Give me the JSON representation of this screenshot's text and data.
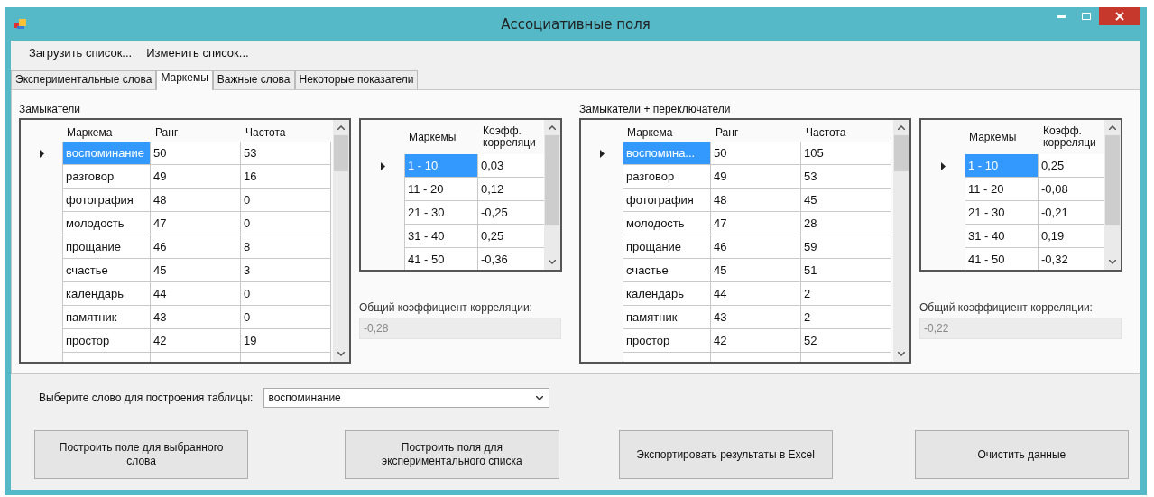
{
  "window": {
    "title": "Ассоциативные поля"
  },
  "menu": [
    {
      "label": "Загрузить список..."
    },
    {
      "label": "Изменить список..."
    }
  ],
  "tabs": [
    {
      "label": "Экспериментальные слова",
      "selected": false
    },
    {
      "label": "Маркемы",
      "selected": true
    },
    {
      "label": "Важные слова",
      "selected": false
    },
    {
      "label": "Некоторые показатели",
      "selected": false
    }
  ],
  "panels": [
    {
      "title": "Замыкатели",
      "grid": {
        "columns": [
          "Маркема",
          "Ранг",
          "Частота"
        ],
        "rows": [
          {
            "selected": true,
            "cells": [
              "воспоминание",
              "50",
              "53"
            ]
          },
          {
            "selected": false,
            "cells": [
              "разговор",
              "49",
              "16"
            ]
          },
          {
            "selected": false,
            "cells": [
              "фотография",
              "48",
              "0"
            ]
          },
          {
            "selected": false,
            "cells": [
              "молодость",
              "47",
              "0"
            ]
          },
          {
            "selected": false,
            "cells": [
              "прощание",
              "46",
              "8"
            ]
          },
          {
            "selected": false,
            "cells": [
              "счастье",
              "45",
              "3"
            ]
          },
          {
            "selected": false,
            "cells": [
              "календарь",
              "44",
              "0"
            ]
          },
          {
            "selected": false,
            "cells": [
              "памятник",
              "43",
              "0"
            ]
          },
          {
            "selected": false,
            "cells": [
              "простор",
              "42",
              "19"
            ]
          }
        ]
      },
      "range_grid": {
        "columns": [
          "Маркемы",
          "Коэфф. корреляци"
        ],
        "rows": [
          {
            "selected": true,
            "cells": [
              "1 - 10",
              "0,03"
            ]
          },
          {
            "selected": false,
            "cells": [
              "11 - 20",
              "0,12"
            ]
          },
          {
            "selected": false,
            "cells": [
              "21 - 30",
              "-0,25"
            ]
          },
          {
            "selected": false,
            "cells": [
              "31 - 40",
              "0,25"
            ]
          },
          {
            "selected": false,
            "cells": [
              "41 - 50",
              "-0,36"
            ]
          }
        ]
      },
      "correlation": {
        "label": "Общий коэффициент корреляции:",
        "value": "-0,28",
        "disabled": true
      }
    },
    {
      "title": "Замыкатели + переключатели",
      "grid": {
        "columns": [
          "Маркема",
          "Ранг",
          "Частота"
        ],
        "rows": [
          {
            "selected": true,
            "cells": [
              "воспомина...",
              "50",
              "105"
            ]
          },
          {
            "selected": false,
            "cells": [
              "разговор",
              "49",
              "53"
            ]
          },
          {
            "selected": false,
            "cells": [
              "фотография",
              "48",
              "45"
            ]
          },
          {
            "selected": false,
            "cells": [
              "молодость",
              "47",
              "28"
            ]
          },
          {
            "selected": false,
            "cells": [
              "прощание",
              "46",
              "59"
            ]
          },
          {
            "selected": false,
            "cells": [
              "счастье",
              "45",
              "51"
            ]
          },
          {
            "selected": false,
            "cells": [
              "календарь",
              "44",
              "2"
            ]
          },
          {
            "selected": false,
            "cells": [
              "памятник",
              "43",
              "2"
            ]
          },
          {
            "selected": false,
            "cells": [
              "простор",
              "42",
              "52"
            ]
          }
        ]
      },
      "range_grid": {
        "columns": [
          "Маркемы",
          "Коэфф. корреляци"
        ],
        "rows": [
          {
            "selected": true,
            "cells": [
              "1 - 10",
              "0,25"
            ]
          },
          {
            "selected": false,
            "cells": [
              "11 - 20",
              "-0,08"
            ]
          },
          {
            "selected": false,
            "cells": [
              "21 - 30",
              "-0,21"
            ]
          },
          {
            "selected": false,
            "cells": [
              "31 - 40",
              "0,19"
            ]
          },
          {
            "selected": false,
            "cells": [
              "41 - 50",
              "-0,32"
            ]
          }
        ]
      },
      "correlation": {
        "label": "Общий коэффициент корреляции:",
        "value": "-0,22",
        "disabled": true
      }
    }
  ],
  "word_select": {
    "label": "Выберите слово для построения таблицы:",
    "value": "воспоминание"
  },
  "buttons": [
    {
      "label": "Построить поле для выбранного слова"
    },
    {
      "label": "Построить поля для экспериментального списка"
    },
    {
      "label": "Экспортировать результаты в Excel"
    },
    {
      "label": "Очистить данные"
    }
  ]
}
